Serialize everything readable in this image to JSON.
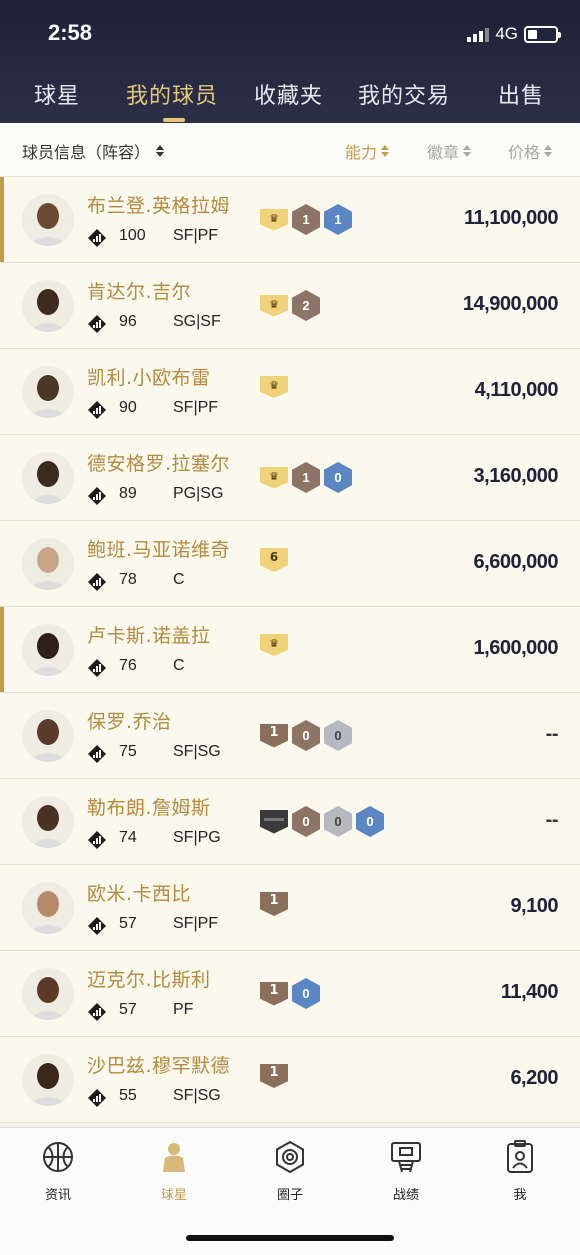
{
  "status": {
    "time": "2:58",
    "network": "4G"
  },
  "nav": {
    "tabs": [
      {
        "label": "球星",
        "active": false
      },
      {
        "label": "我的球员",
        "active": true
      },
      {
        "label": "收藏夹",
        "active": false
      },
      {
        "label": "我的交易",
        "active": false
      },
      {
        "label": "出售",
        "active": false
      }
    ]
  },
  "sortbar": {
    "info_label": "球员信息（阵容）",
    "ability_label": "能力",
    "badge_label": "徽章",
    "price_label": "价格"
  },
  "players": [
    {
      "name": "布兰登.英格拉姆",
      "rating": "100",
      "position": "SF|PF",
      "price": "11,100,000",
      "badges": [
        "crown",
        "bronze:1",
        "blue:1"
      ],
      "icon": "stat"
    },
    {
      "name": "肯达尔.吉尔",
      "rating": "96",
      "position": "SG|SF",
      "price": "14,900,000",
      "badges": [
        "crown",
        "bronze:2"
      ],
      "icon": "99"
    },
    {
      "name": "凯利.小欧布雷",
      "rating": "90",
      "position": "SF|PF",
      "price": "4,110,000",
      "badges": [
        "crown"
      ],
      "icon": "stat"
    },
    {
      "name": "德安格罗.拉塞尔",
      "rating": "89",
      "position": "PG|SG",
      "price": "3,160,000",
      "badges": [
        "crown",
        "bronze:1",
        "blue:0"
      ],
      "icon": "stat"
    },
    {
      "name": "鲍班.马亚诺维奇",
      "rating": "78",
      "position": "C",
      "price": "6,600,000",
      "badges": [
        "flag6:6"
      ],
      "icon": "stat"
    },
    {
      "name": "卢卡斯.诺盖拉",
      "rating": "76",
      "position": "C",
      "price": "1,600,000",
      "badges": [
        "crown"
      ],
      "icon": "stat"
    },
    {
      "name": "保罗.乔治",
      "rating": "75",
      "position": "SF|SG",
      "price": "--",
      "badges": [
        "flagb:1",
        "bronze:0",
        "silver:0"
      ],
      "icon": "copy"
    },
    {
      "name": "勒布朗.詹姆斯",
      "rating": "74",
      "position": "SF|PG",
      "price": "--",
      "badges": [
        "flagd",
        "bronze:0",
        "silver:0",
        "blue:0"
      ],
      "icon": "stat"
    },
    {
      "name": "欧米.卡西比",
      "rating": "57",
      "position": "SF|PF",
      "price": "9,100",
      "badges": [
        "flagb:1"
      ],
      "icon": "stat"
    },
    {
      "name": "迈克尔.比斯利",
      "rating": "57",
      "position": "PF",
      "price": "11,400",
      "badges": [
        "flagb:1",
        "blue:0"
      ],
      "icon": "stat"
    },
    {
      "name": "沙巴兹.穆罕默德",
      "rating": "55",
      "position": "SF|SG",
      "price": "6,200",
      "badges": [
        "flagb:1"
      ],
      "icon": "stat"
    }
  ],
  "bottom_nav": [
    {
      "label": "资讯",
      "icon": "basketball-icon",
      "active": false
    },
    {
      "label": "球星",
      "icon": "player-icon",
      "active": true
    },
    {
      "label": "圈子",
      "icon": "circle-icon",
      "active": false
    },
    {
      "label": "战绩",
      "icon": "hoop-icon",
      "active": false
    },
    {
      "label": "我",
      "icon": "profile-icon",
      "active": false
    }
  ],
  "colors": {
    "accent": "#c49a4b",
    "header": "#232740",
    "price": "#20213a"
  }
}
